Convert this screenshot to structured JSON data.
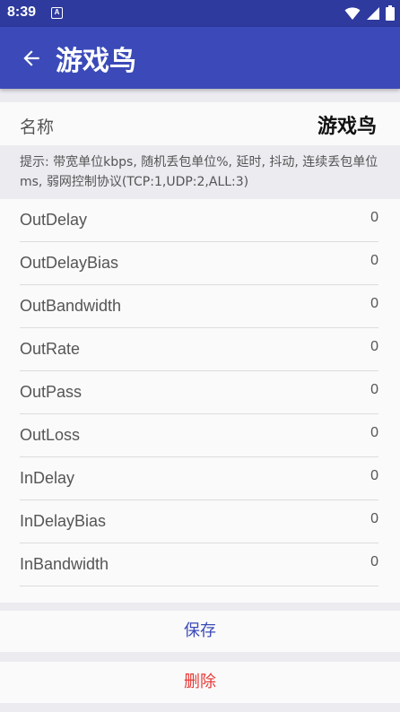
{
  "status_bar": {
    "time": "8:39",
    "notification_glyph": "A",
    "icons": [
      "wifi-icon",
      "signal-icon",
      "battery-icon"
    ]
  },
  "app_bar": {
    "title": "游戏鸟",
    "back_icon": "arrow-left-icon"
  },
  "name_field": {
    "label": "名称",
    "value": "游戏鸟"
  },
  "hint": {
    "text": "提示: 带宽单位kbps, 随机丢包单位%, 延时, 抖动, 连续丢包单位ms, 弱网控制协议(TCP:1,UDP:2,ALL:3)"
  },
  "params": [
    {
      "key": "OutDelay",
      "value": "0"
    },
    {
      "key": "OutDelayBias",
      "value": "0"
    },
    {
      "key": "OutBandwidth",
      "value": "0"
    },
    {
      "key": "OutRate",
      "value": "0"
    },
    {
      "key": "OutPass",
      "value": "0"
    },
    {
      "key": "OutLoss",
      "value": "0"
    },
    {
      "key": "InDelay",
      "value": "0"
    },
    {
      "key": "InDelayBias",
      "value": "0"
    },
    {
      "key": "InBandwidth",
      "value": "0"
    }
  ],
  "actions": {
    "save_label": "保存",
    "delete_label": "删除"
  },
  "colors": {
    "status_bar": "#2e3a9e",
    "app_bar": "#3b4ab8",
    "save_text": "#3b4ab8",
    "delete_text": "#e53935"
  }
}
